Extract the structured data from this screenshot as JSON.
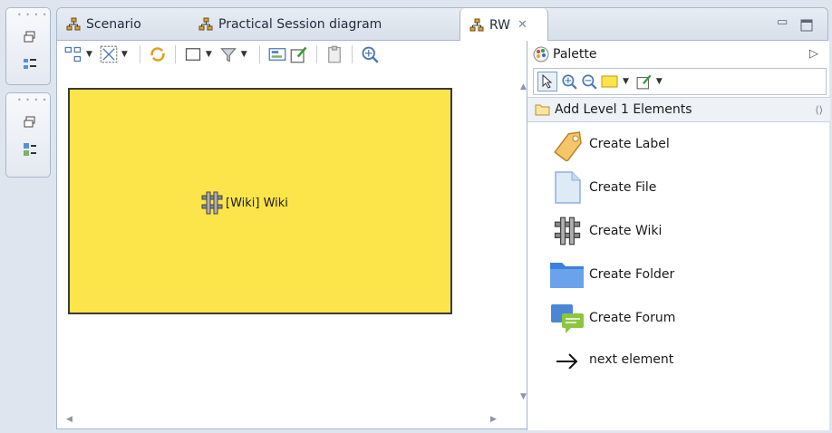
{
  "tabs": [
    {
      "label": "Scenario",
      "icon": "diagram-icon"
    },
    {
      "label": "Practical Session diagram",
      "icon": "diagram-icon"
    },
    {
      "label": "RW",
      "icon": "diagram-icon",
      "active": true
    }
  ],
  "canvas": {
    "node": {
      "label": "[Wiki] Wiki",
      "type": "wiki",
      "fill_color": "#fce54a"
    }
  },
  "palette": {
    "title": "Palette",
    "drawer": {
      "label": "Add Level 1 Elements"
    },
    "items": [
      {
        "label": "Create Label",
        "icon": "tag-icon"
      },
      {
        "label": "Create File",
        "icon": "file-icon"
      },
      {
        "label": "Create Wiki",
        "icon": "wiki-icon"
      },
      {
        "label": "Create Folder",
        "icon": "folder-icon"
      },
      {
        "label": "Create Forum",
        "icon": "forum-icon"
      },
      {
        "label": "next element",
        "icon": "arrow-right-icon"
      }
    ]
  },
  "colors": {
    "accent": "#a9b7cc",
    "node_fill": "#fce54a",
    "background": "#dfe5ee"
  }
}
